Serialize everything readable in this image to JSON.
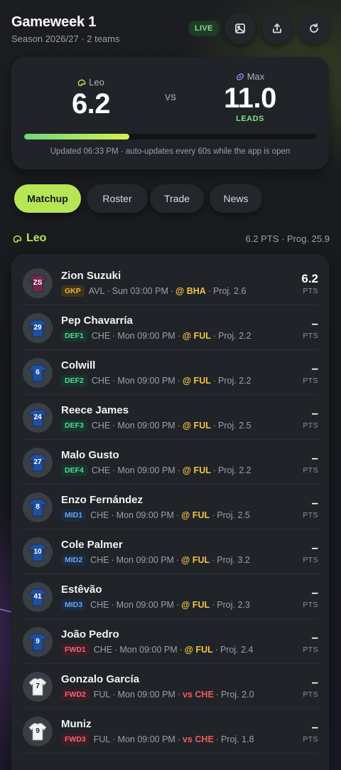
{
  "header": {
    "title": "Gameweek 1",
    "subtitle": "Season 2026/27 · 2 teams",
    "live_label": "LIVE"
  },
  "scoreboard": {
    "home": {
      "name": "Leo",
      "score": "6.2"
    },
    "vs_label": "VS",
    "away": {
      "name": "Max",
      "score": "11.0",
      "status": "LEADS"
    },
    "progress": 0.36,
    "updated_text": "Updated 06:33 PM · auto-updates every 60s while the app is open"
  },
  "tabs": [
    "Matchup",
    "Roster",
    "Trade",
    "News"
  ],
  "active_tab": "Matchup",
  "team_section": {
    "name": "Leo",
    "summary": "6.2 PTS · Prog. 25.9"
  },
  "players": [
    {
      "kit": "ZS",
      "kit_style": "claret",
      "name": "Zion Suzuki",
      "pos": "GKP",
      "pos_type": "gk",
      "club": "AVL",
      "kickoff": "Sun 03:00 PM",
      "opp": "@ BHA",
      "opp_type": "away",
      "proj": "Proj. 2.6",
      "pts": "6.2",
      "pts_label": "PTS"
    },
    {
      "kit": "29",
      "kit_style": "blue",
      "name": "Pep Chavarría",
      "pos": "DEF1",
      "pos_type": "def",
      "club": "CHE",
      "kickoff": "Mon 09:00 PM",
      "opp": "@ FUL",
      "opp_type": "away",
      "proj": "Proj. 2.2",
      "pts": "–",
      "pts_label": "PTS"
    },
    {
      "kit": "6",
      "kit_style": "blue",
      "name": "Colwill",
      "pos": "DEF2",
      "pos_type": "def",
      "club": "CHE",
      "kickoff": "Mon 09:00 PM",
      "opp": "@ FUL",
      "opp_type": "away",
      "proj": "Proj. 2.2",
      "pts": "–",
      "pts_label": "PTS"
    },
    {
      "kit": "24",
      "kit_style": "blue",
      "name": "Reece James",
      "pos": "DEF3",
      "pos_type": "def",
      "club": "CHE",
      "kickoff": "Mon 09:00 PM",
      "opp": "@ FUL",
      "opp_type": "away",
      "proj": "Proj. 2.5",
      "pts": "–",
      "pts_label": "PTS"
    },
    {
      "kit": "27",
      "kit_style": "blue",
      "name": "Malo Gusto",
      "pos": "DEF4",
      "pos_type": "def",
      "club": "CHE",
      "kickoff": "Mon 09:00 PM",
      "opp": "@ FUL",
      "opp_type": "away",
      "proj": "Proj. 2.2",
      "pts": "–",
      "pts_label": "PTS"
    },
    {
      "kit": "8",
      "kit_style": "blue",
      "name": "Enzo Fernández",
      "pos": "MID1",
      "pos_type": "mid",
      "club": "CHE",
      "kickoff": "Mon 09:00 PM",
      "opp": "@ FUL",
      "opp_type": "away",
      "proj": "Proj. 2.5",
      "pts": "–",
      "pts_label": "PTS"
    },
    {
      "kit": "10",
      "kit_style": "blue",
      "name": "Cole Palmer",
      "pos": "MID2",
      "pos_type": "mid",
      "club": "CHE",
      "kickoff": "Mon 09:00 PM",
      "opp": "@ FUL",
      "opp_type": "away",
      "proj": "Proj. 3.2",
      "pts": "–",
      "pts_label": "PTS"
    },
    {
      "kit": "41",
      "kit_style": "blue",
      "name": "Estêvão",
      "pos": "MID3",
      "pos_type": "mid",
      "club": "CHE",
      "kickoff": "Mon 09:00 PM",
      "opp": "@ FUL",
      "opp_type": "away",
      "proj": "Proj. 2.3",
      "pts": "–",
      "pts_label": "PTS"
    },
    {
      "kit": "9",
      "kit_style": "blue",
      "name": "João Pedro",
      "pos": "FWD1",
      "pos_type": "fwd",
      "club": "CHE",
      "kickoff": "Mon 09:00 PM",
      "opp": "@ FUL",
      "opp_type": "away",
      "proj": "Proj. 2.4",
      "pts": "–",
      "pts_label": "PTS"
    },
    {
      "kit": "7",
      "kit_style": "white",
      "name": "Gonzalo García",
      "pos": "FWD2",
      "pos_type": "fwd",
      "club": "FUL",
      "kickoff": "Mon 09:00 PM",
      "opp": "vs CHE",
      "opp_type": "home",
      "proj": "Proj. 2.0",
      "pts": "–",
      "pts_label": "PTS"
    },
    {
      "kit": "9",
      "kit_style": "white",
      "name": "Muniz",
      "pos": "FWD3",
      "pos_type": "fwd",
      "club": "FUL",
      "kickoff": "Mon 09:00 PM",
      "opp": "vs CHE",
      "opp_type": "home",
      "proj": "Proj. 1.8",
      "pts": "–",
      "pts_label": "PTS"
    }
  ],
  "colors": {
    "accent": "#b7e655",
    "lead_green": "#7fe08c",
    "away_opp": "#f0c53d",
    "home_opp": "#f05a5a",
    "card": "#202328",
    "chelsea_blue": "#1f4fa0",
    "villa_claret": "#7a2640"
  },
  "icons": {
    "home_team": "helmet-icon",
    "away_team": "football-icon",
    "image_button": "image-icon",
    "share_button": "share-icon",
    "refresh_button": "refresh-icon"
  }
}
